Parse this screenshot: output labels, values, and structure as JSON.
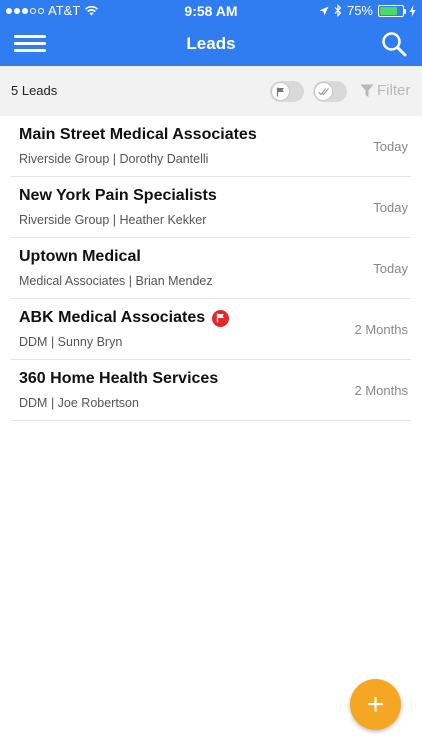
{
  "status_bar": {
    "carrier": "AT&T",
    "time": "9:58 AM",
    "battery_percent": "75%",
    "battery_level": 0.75,
    "signal_bars_filled": 3,
    "signal_bars_total": 5,
    "icons": [
      "wifi-icon",
      "location-icon",
      "bluetooth-icon",
      "battery-icon",
      "charging-icon"
    ]
  },
  "nav": {
    "title": "Leads",
    "left_icon": "hamburger-menu-icon",
    "right_icon": "search-icon"
  },
  "toolbar": {
    "count_label": "5 Leads",
    "filter_label": "Filter",
    "toggles": [
      {
        "icon": "flag-icon",
        "on": false
      },
      {
        "icon": "double-check-icon",
        "on": false
      }
    ]
  },
  "leads": [
    {
      "name": "Main Street Medical Associates",
      "subtitle": "Riverside Group | Dorothy Dantelli",
      "date": "Today",
      "flagged": false
    },
    {
      "name": "New York Pain Specialists",
      "subtitle": "Riverside Group | Heather Kekker",
      "date": "Today",
      "flagged": false
    },
    {
      "name": "Uptown Medical",
      "subtitle": "Medical Associates | Brian Mendez",
      "date": "Today",
      "flagged": false
    },
    {
      "name": "ABK Medical Associates",
      "subtitle": "DDM | Sunny Bryn",
      "date": "2 Months",
      "flagged": true
    },
    {
      "name": "360 Home Health Services",
      "subtitle": "DDM | Joe Robertson",
      "date": "2 Months",
      "flagged": false
    }
  ],
  "fab": {
    "symbol": "+"
  },
  "colors": {
    "primary": "#2f7df0",
    "toolbar_bg": "#f2f2f2",
    "fab": "#f5a623",
    "flag_badge": "#e8262a",
    "battery": "#4cd964"
  }
}
